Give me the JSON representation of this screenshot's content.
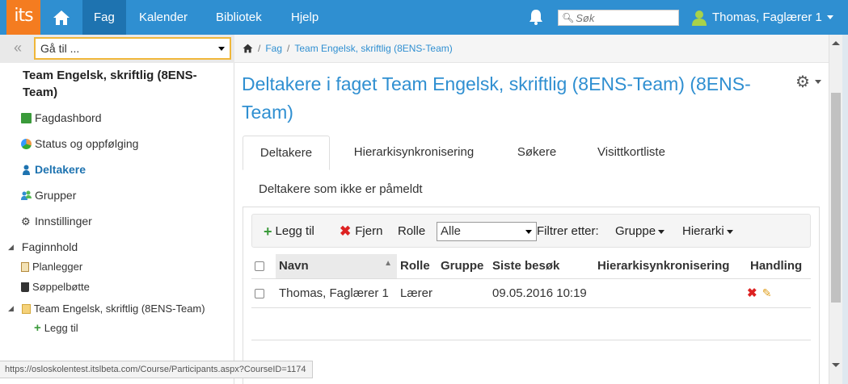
{
  "app": {
    "logo_text": "its",
    "accent_color": "#2f8fd1",
    "logo_color": "#f47c20"
  },
  "nav": {
    "items": [
      {
        "label": "Fag",
        "active": true
      },
      {
        "label": "Kalender"
      },
      {
        "label": "Bibliotek"
      },
      {
        "label": "Hjelp"
      }
    ],
    "search_placeholder": "Søk",
    "user_name": "Thomas, Faglærer 1"
  },
  "sidebar": {
    "goto_label": "Gå til ...",
    "course_title": "Team Engelsk, skriftlig (8ENS-Team)",
    "items": [
      {
        "label": "Fagdashbord",
        "icon": "dashboard-icon"
      },
      {
        "label": "Status og oppfølging",
        "icon": "status-icon"
      },
      {
        "label": "Deltakere",
        "icon": "person-icon",
        "active": true
      },
      {
        "label": "Grupper",
        "icon": "group-icon"
      },
      {
        "label": "Innstillinger",
        "icon": "gear-icon"
      }
    ],
    "tree": {
      "root_label": "Faginnhold",
      "children": [
        {
          "label": "Planlegger",
          "icon": "clipboard-icon"
        },
        {
          "label": "Søppelbøtte",
          "icon": "trash-icon"
        },
        {
          "label": "Team Engelsk, skriftlig (8ENS-Team)",
          "icon": "folder-icon"
        },
        {
          "label": "Legg til",
          "icon": "plus-icon"
        }
      ]
    }
  },
  "breadcrumb": {
    "items": [
      "Fag",
      "Team Engelsk, skriftlig (8ENS-Team)"
    ]
  },
  "page": {
    "title": "Deltakere i faget Team Engelsk, skriftlig (8ENS-Team) (8ENS-Team)",
    "tabs": [
      "Deltakere",
      "Hierarkisynkronisering",
      "Søkere",
      "Visittkortliste"
    ],
    "tab_row2": "Deltakere som ikke er påmeldt"
  },
  "toolbar": {
    "add_label": "Legg til",
    "remove_label": "Fjern",
    "role_label": "Rolle",
    "role_value": "Alle",
    "filter_label": "Filtrer etter:",
    "group_label": "Gruppe",
    "hierarchy_label": "Hierarki"
  },
  "table": {
    "headers": [
      "Navn",
      "Rolle",
      "Gruppe",
      "Siste besøk",
      "Hierarkisynkronisering",
      "Handling"
    ],
    "rows": [
      {
        "name": "Thomas, Faglærer 1",
        "role": "Lærer",
        "group": "",
        "last_visit": "09.05.2016 10:19",
        "sync": ""
      }
    ]
  },
  "status_url": "https://osloskolentest.itslbeta.com/Course/Participants.aspx?CourseID=1174"
}
